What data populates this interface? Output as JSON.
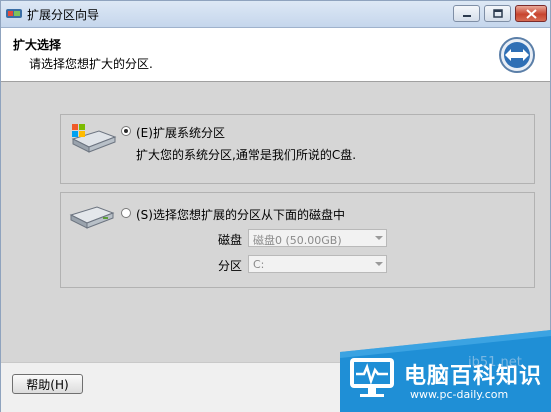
{
  "window": {
    "title": "扩展分区向导"
  },
  "header": {
    "title": "扩大选择",
    "subtitle": "请选择您想扩大的分区."
  },
  "option_system": {
    "label": "(E)扩展系统分区",
    "description": "扩大您的系统分区,通常是我们所说的C盘.",
    "selected": true
  },
  "option_other": {
    "label": "(S)选择您想扩展的分区从下面的磁盘中",
    "selected": false,
    "disk_label": "磁盘",
    "disk_value": "磁盘0 (50.00GB)",
    "partition_label": "分区",
    "partition_value": "C:"
  },
  "footer": {
    "help_label": "帮助(H)"
  },
  "watermark": {
    "title": "电脑百科知识",
    "url": "www.pc-daily.com",
    "ghost": "ib51.net"
  },
  "icons": {
    "app": "app-icon",
    "minimize": "minimize-icon",
    "maximize": "maximize-icon",
    "close": "close-icon",
    "header": "arrows-expand-icon",
    "system_drive": "windows-drive-icon",
    "disk_drive": "hard-drive-icon"
  },
  "colors": {
    "close": "#c8452f",
    "header_icon": "#2f6fb5",
    "watermark": "#1f8fd6"
  }
}
